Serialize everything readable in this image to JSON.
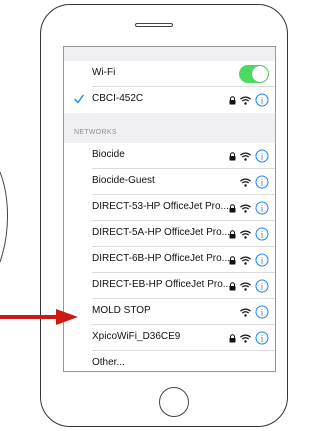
{
  "wifi": {
    "label": "Wi-Fi",
    "enabled": true,
    "toggle_color": "#4cd964"
  },
  "connected": {
    "name": "CBCI-452C",
    "secured": true
  },
  "section_title": "NETWORKS",
  "networks": [
    {
      "name": "Biocide",
      "secured": true
    },
    {
      "name": "Biocide-Guest",
      "secured": false
    },
    {
      "name": "DIRECT-53-HP OfficeJet Pro...",
      "secured": true
    },
    {
      "name": "DIRECT-5A-HP OfficeJet Pro...",
      "secured": true
    },
    {
      "name": "DIRECT-6B-HP OfficeJet Pro...",
      "secured": true
    },
    {
      "name": "DIRECT-EB-HP OfficeJet Pro...",
      "secured": true
    },
    {
      "name": "MOLD STOP",
      "secured": false
    },
    {
      "name": "XpicoWiFi_D36CE9",
      "secured": true
    },
    {
      "name": "Other...",
      "secured": false,
      "other": true
    }
  ],
  "accent_color": "#1a82fb",
  "arrow": {
    "color": "#cc1a12",
    "points_to": "MOLD STOP"
  }
}
